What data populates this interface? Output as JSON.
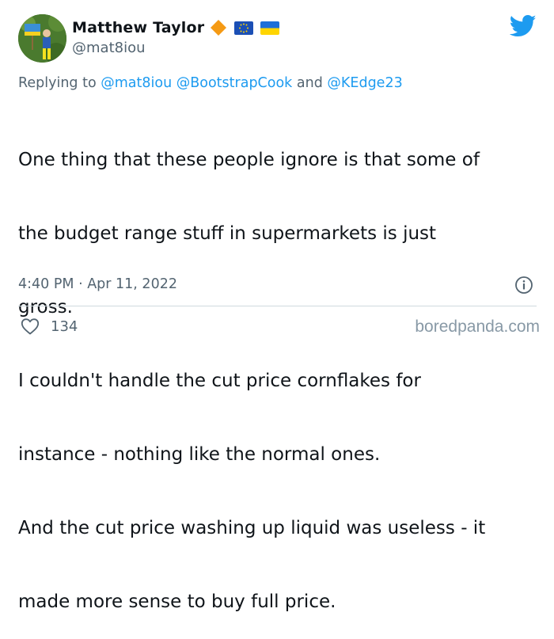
{
  "author": {
    "display_name": "Matthew Taylor",
    "handle": "@mat8iou",
    "badges": [
      "orange-diamond-icon",
      "eu-flag-icon",
      "ukraine-flag-icon"
    ]
  },
  "reply": {
    "prefix": "Replying to",
    "mention_1": "@mat8iou",
    "mention_2": "@BootstrapCook",
    "conjunction": "and",
    "mention_3": "@KEdge23"
  },
  "tweet": {
    "line_1": "One thing that these people ignore is that some of",
    "line_2": "the budget range stuff in supermarkets is just",
    "line_3": "gross.",
    "line_4": "I couldn't handle the cut price cornflakes for",
    "line_5": "instance - nothing like the normal ones.",
    "line_6": "And the cut price washing up liquid was useless - it",
    "line_7": "made more sense to buy full price.",
    "timestamp": "4:40 PM · Apr 11, 2022"
  },
  "engagement": {
    "likes": "134"
  },
  "watermark": "boredpanda.com",
  "colors": {
    "twitter_blue": "#1d9bf0",
    "secondary_text": "#536471",
    "primary_text": "#0f1419",
    "divider": "#cfd9de"
  }
}
